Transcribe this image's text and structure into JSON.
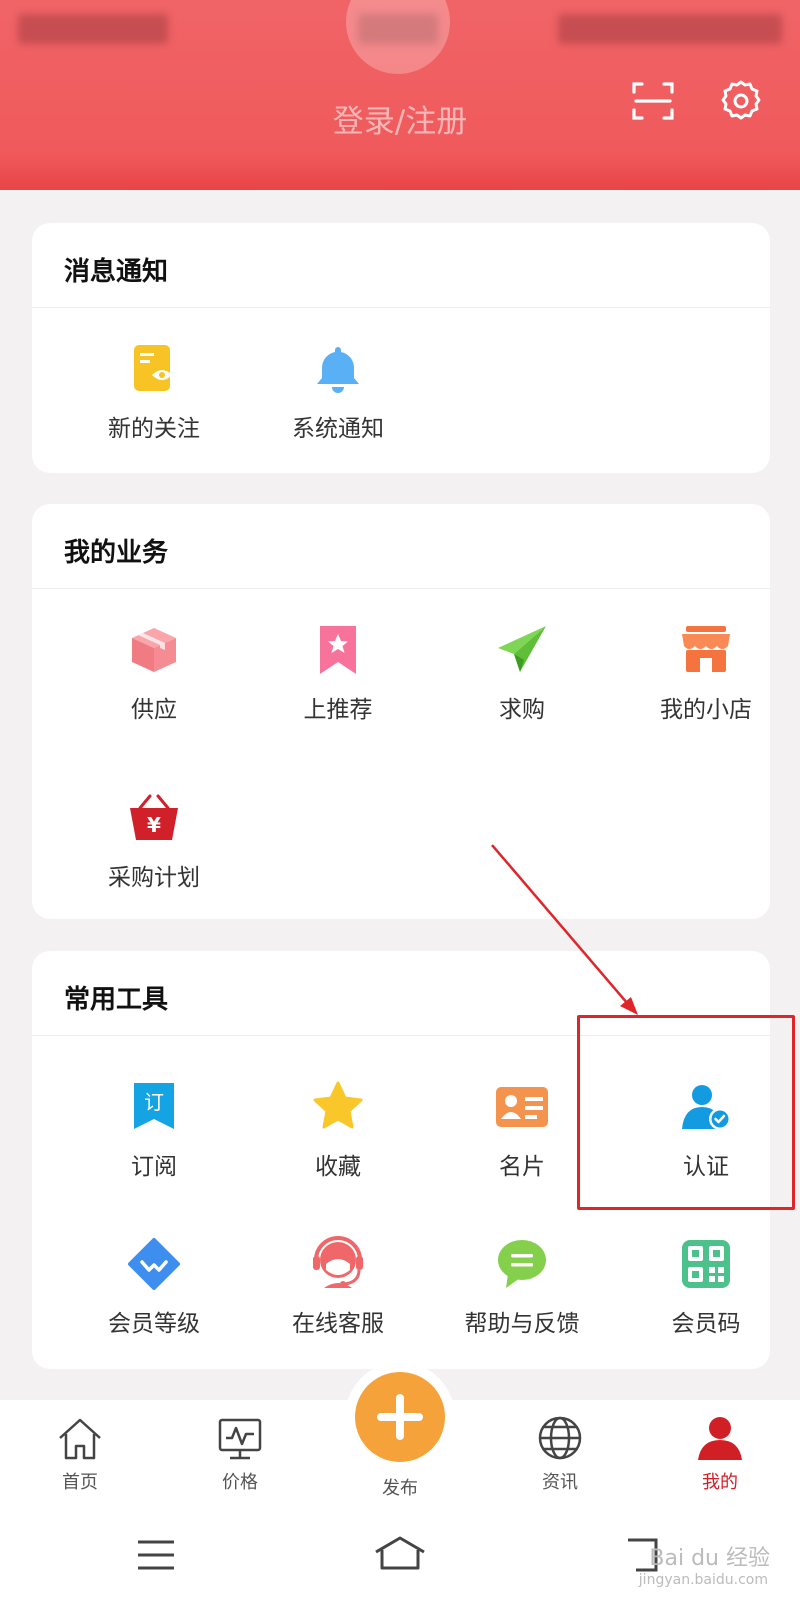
{
  "header": {
    "login_label": "登录/注册",
    "colors": {
      "primary": "#f05a5c",
      "accent": "#e94446"
    },
    "icons": [
      "scan-icon",
      "settings-gear-icon"
    ]
  },
  "messages": {
    "title": "消息通知",
    "items": [
      {
        "label": "新的关注",
        "icon": "eye-document-icon"
      },
      {
        "label": "系统通知",
        "icon": "bell-icon"
      }
    ]
  },
  "business": {
    "title": "我的业务",
    "items": [
      {
        "label": "供应",
        "icon": "box-icon"
      },
      {
        "label": "上推荐",
        "icon": "bookmark-star-icon"
      },
      {
        "label": "求购",
        "icon": "paper-plane-icon"
      },
      {
        "label": "我的小店",
        "icon": "shop-icon"
      },
      {
        "label": "采购计划",
        "icon": "yen-basket-icon"
      }
    ]
  },
  "tools": {
    "title": "常用工具",
    "items": [
      {
        "label": "订阅",
        "icon": "subscribe-bookmark-icon",
        "badge": "订"
      },
      {
        "label": "收藏",
        "icon": "star-icon"
      },
      {
        "label": "名片",
        "icon": "business-card-icon"
      },
      {
        "label": "认证",
        "icon": "verified-user-icon"
      },
      {
        "label": "会员等级",
        "icon": "diamond-icon"
      },
      {
        "label": "在线客服",
        "icon": "headset-agent-icon"
      },
      {
        "label": "帮助与反馈",
        "icon": "chat-bubble-icon"
      },
      {
        "label": "会员码",
        "icon": "qr-code-icon"
      }
    ]
  },
  "tabbar": {
    "items": [
      {
        "label": "首页",
        "icon": "home-icon"
      },
      {
        "label": "价格",
        "icon": "price-chart-icon"
      },
      {
        "label": "发布",
        "icon": "plus-icon"
      },
      {
        "label": "资讯",
        "icon": "globe-icon"
      },
      {
        "label": "我的",
        "icon": "user-icon",
        "active": true
      }
    ],
    "active_color": "#d11f26",
    "publish_color": "#f6a23a"
  },
  "watermark": {
    "brand": "Bai du 经验",
    "url": "jingyan.baidu.com"
  }
}
